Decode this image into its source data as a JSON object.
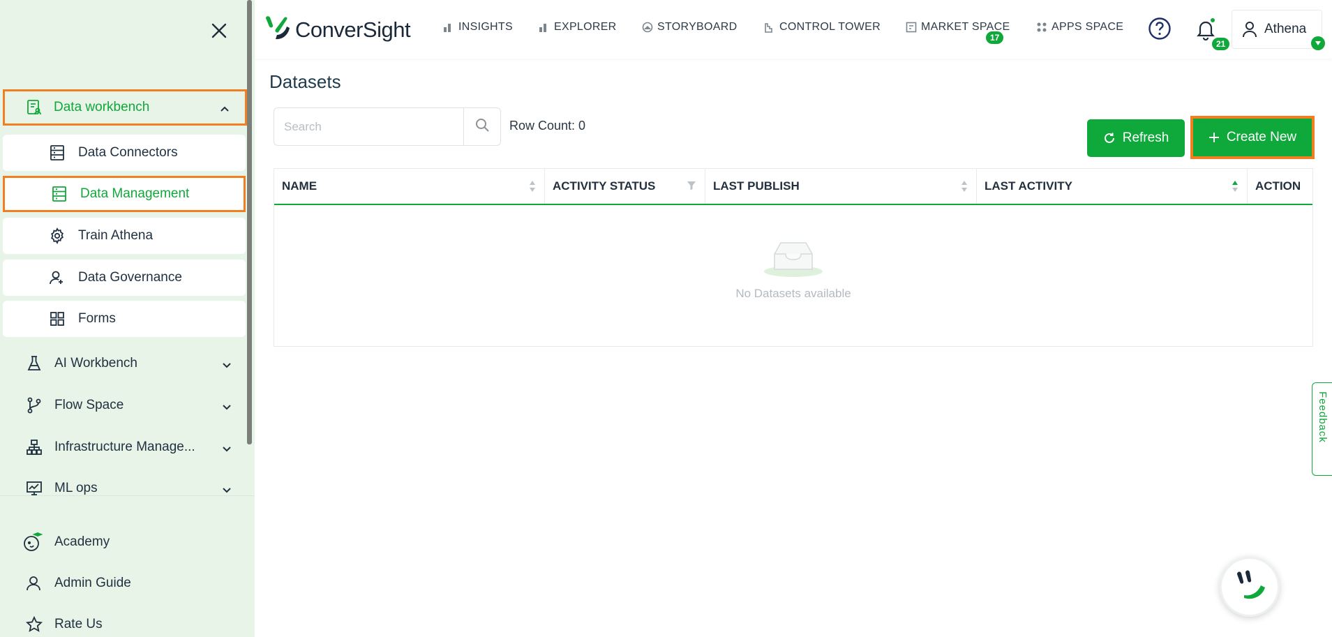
{
  "brand": {
    "name": "ConverSight",
    "accent": "#10a83a",
    "highlight": "#f07f22"
  },
  "sidebar": {
    "close_icon": "close-icon",
    "group": {
      "label": "Data workbench",
      "icon": "document-user-icon",
      "expanded": true
    },
    "sub_items": [
      {
        "label": "Data Connectors",
        "icon": "server-icon",
        "active": false
      },
      {
        "label": "Data Management",
        "icon": "server-icon",
        "active": true
      },
      {
        "label": "Train Athena",
        "icon": "gear-icon",
        "active": false
      },
      {
        "label": "Data Governance",
        "icon": "user-shield-icon",
        "active": false
      },
      {
        "label": "Forms",
        "icon": "grid-icon",
        "active": false
      }
    ],
    "sections": [
      {
        "label": "AI Workbench",
        "icon": "flask-icon"
      },
      {
        "label": "Flow Space",
        "icon": "branch-icon"
      },
      {
        "label": "Infrastructure Manage...",
        "icon": "hierarchy-icon"
      },
      {
        "label": "ML ops",
        "icon": "monitor-chart-icon"
      }
    ],
    "bottom": [
      {
        "label": "Academy",
        "icon": "academy-icon"
      },
      {
        "label": "Admin Guide",
        "icon": "user-icon"
      },
      {
        "label": "Rate Us",
        "icon": "star-icon"
      }
    ]
  },
  "header": {
    "nav": [
      {
        "label": "INSIGHTS",
        "icon": "bar-chart-icon"
      },
      {
        "label": "EXPLORER",
        "icon": "bar-chart-icon"
      },
      {
        "label": "STORYBOARD",
        "icon": "storyboard-icon",
        "badge": "17"
      },
      {
        "label": "CONTROL TOWER",
        "icon": "tower-icon"
      },
      {
        "label": "MARKET SPACE",
        "icon": "market-icon"
      },
      {
        "label": "APPS SPACE",
        "icon": "apps-icon"
      }
    ],
    "notifications": "21",
    "user": "Athena"
  },
  "main": {
    "title": "Datasets",
    "search_placeholder": "Search",
    "row_count": "Row Count: 0",
    "refresh_label": "Refresh",
    "create_label": "Create New",
    "columns": [
      "NAME",
      "ACTIVITY STATUS",
      "LAST PUBLISH",
      "LAST ACTIVITY",
      "ACTION"
    ],
    "empty_text": "No Datasets available"
  },
  "feedback_label": "Feedback"
}
